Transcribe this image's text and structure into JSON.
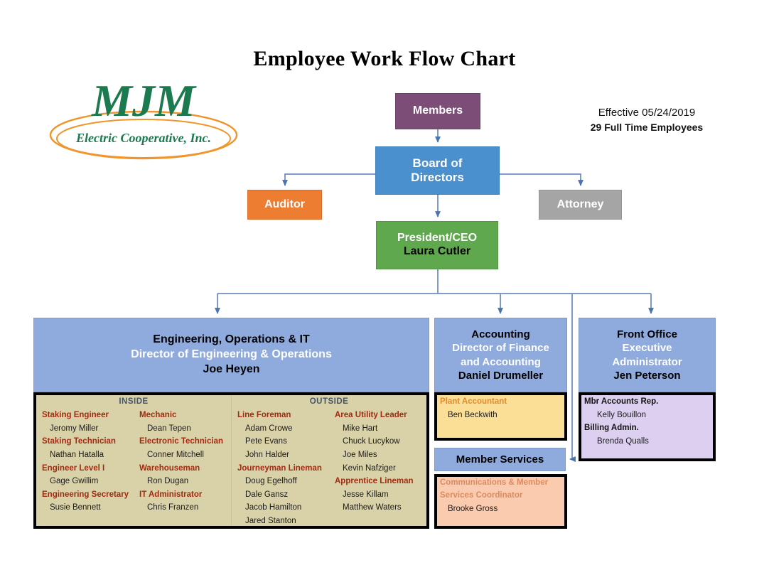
{
  "title": "Employee Work Flow Chart",
  "logo": {
    "name": "MJM",
    "tagline": "Electric Cooperative, Inc."
  },
  "effective": {
    "date_line": "Effective 05/24/2019",
    "employees_line": "29  Full Time Employees"
  },
  "nodes": {
    "members": "Members",
    "board_line1": "Board of",
    "board_line2": "Directors",
    "auditor": "Auditor",
    "attorney": "Attorney",
    "ceo_title": "President/CEO",
    "ceo_name": "Laura Cutler",
    "member_services": "Member Services"
  },
  "departments": {
    "engineering": {
      "line1": "Engineering, Operations & IT",
      "line2": "Director of Engineering & Operations",
      "name": "Joe Heyen",
      "inside_header": "INSIDE",
      "outside_header": "OUTSIDE",
      "inside_col1": [
        {
          "role": "Staking Engineer",
          "people": [
            "Jeromy Miller"
          ]
        },
        {
          "role": "Staking Technician",
          "people": [
            "Nathan Hatalla"
          ]
        },
        {
          "role": "Engineer Level I",
          "people": [
            "Gage Gwillim"
          ]
        },
        {
          "role": "Engineering Secretary",
          "people": [
            "Susie Bennett"
          ]
        }
      ],
      "inside_col2": [
        {
          "role": "Mechanic",
          "people": [
            "Dean Tepen"
          ]
        },
        {
          "role": "Electronic Technician",
          "people": [
            "Conner Mitchell"
          ]
        },
        {
          "role": "Warehouseman",
          "people": [
            "Ron Dugan"
          ]
        },
        {
          "role": "IT Administrator",
          "people": [
            "Chris Franzen"
          ]
        }
      ],
      "outside_col1": [
        {
          "role": "Line Foreman",
          "people": [
            "Adam Crowe",
            "Pete Evans",
            "John Halder"
          ]
        },
        {
          "role": "Journeyman Lineman",
          "people": [
            "Doug Egelhoff",
            "Dale Gansz",
            "Jacob Hamilton",
            "Jared Stanton"
          ]
        }
      ],
      "outside_col2": [
        {
          "role": "Area Utility Leader",
          "people": [
            "Mike Hart",
            "Chuck Lucykow",
            "Joe Miles",
            "Kevin Nafziger"
          ]
        },
        {
          "role": "Apprentice Lineman",
          "people": [
            "Jesse Killam",
            "Matthew Waters"
          ]
        }
      ]
    },
    "accounting": {
      "line1": "Accounting",
      "line2": "Director of Finance",
      "line3": "and Accounting",
      "name": "Daniel Drumeller",
      "staff": [
        {
          "role": "Plant Accountant",
          "people": [
            "Ben Beckwith"
          ]
        }
      ]
    },
    "front_office": {
      "line1": "Front Office",
      "line2": "Executive",
      "line3": "Administrator",
      "name": "Jen Peterson",
      "staff": [
        {
          "role": "Mbr Accounts Rep.",
          "people": [
            "Kelly Bouillon"
          ]
        },
        {
          "role": "Billing Admin.",
          "people": [
            "Brenda Qualls"
          ]
        }
      ]
    },
    "member_services": {
      "staff": [
        {
          "role_line1": "Communications & Member",
          "role_line2": "Services Coordinator",
          "people": [
            "Brooke Gross"
          ]
        }
      ]
    }
  },
  "colors": {
    "members": "#7C4D77",
    "board": "#4A90CE",
    "auditor": "#ED7D31",
    "attorney": "#A5A5A5",
    "ceo": "#5FA84E",
    "department": "#8FAADC",
    "engineering_staff": "#D9D2A8",
    "accounting_staff": "#FCDF96",
    "front_office_staff": "#DCCFF0",
    "member_services_staff": "#FBCBAF",
    "role_red": "#A02B11",
    "connector": "#6E8FBF",
    "logo_green": "#1B7A4F",
    "logo_orange": "#F0952B"
  }
}
